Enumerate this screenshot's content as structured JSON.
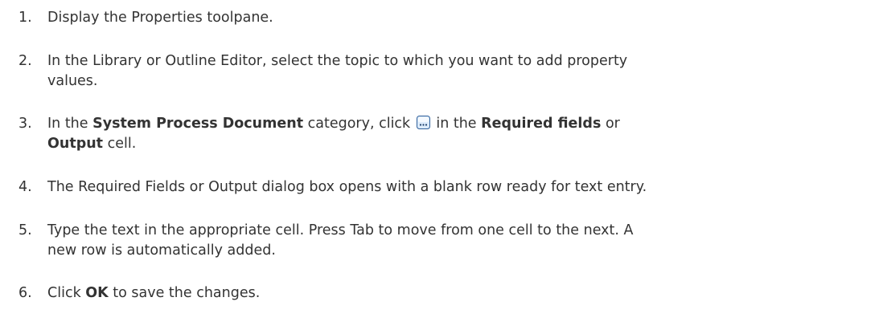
{
  "steps": [
    {
      "number": "1.",
      "text": "Display the Properties toolpane."
    },
    {
      "number": "2.",
      "text": "In the Library or Outline Editor, select the topic to which you want to add property values."
    },
    {
      "number": "3.",
      "pre": "In the ",
      "bold1": "System Process Document",
      "mid1": " category, click ",
      "icon": "ellipsis-button-icon",
      "mid2": " in the ",
      "bold2": "Required fields",
      "mid3": " or ",
      "bold3": "Output",
      "post": " cell."
    },
    {
      "number": "4.",
      "text": "The Required Fields or Output dialog box opens with a blank row ready for text entry."
    },
    {
      "number": "5.",
      "text": "Type the text in the appropriate cell. Press Tab to move from one cell to the next. A new row is automatically added."
    },
    {
      "number": "6.",
      "pre": "Click ",
      "bold1": "OK",
      "post": " to save the changes."
    }
  ],
  "colors": {
    "text": "#333333",
    "icon_border": "#2f5f9a",
    "icon_fill": "#dcebfb"
  }
}
